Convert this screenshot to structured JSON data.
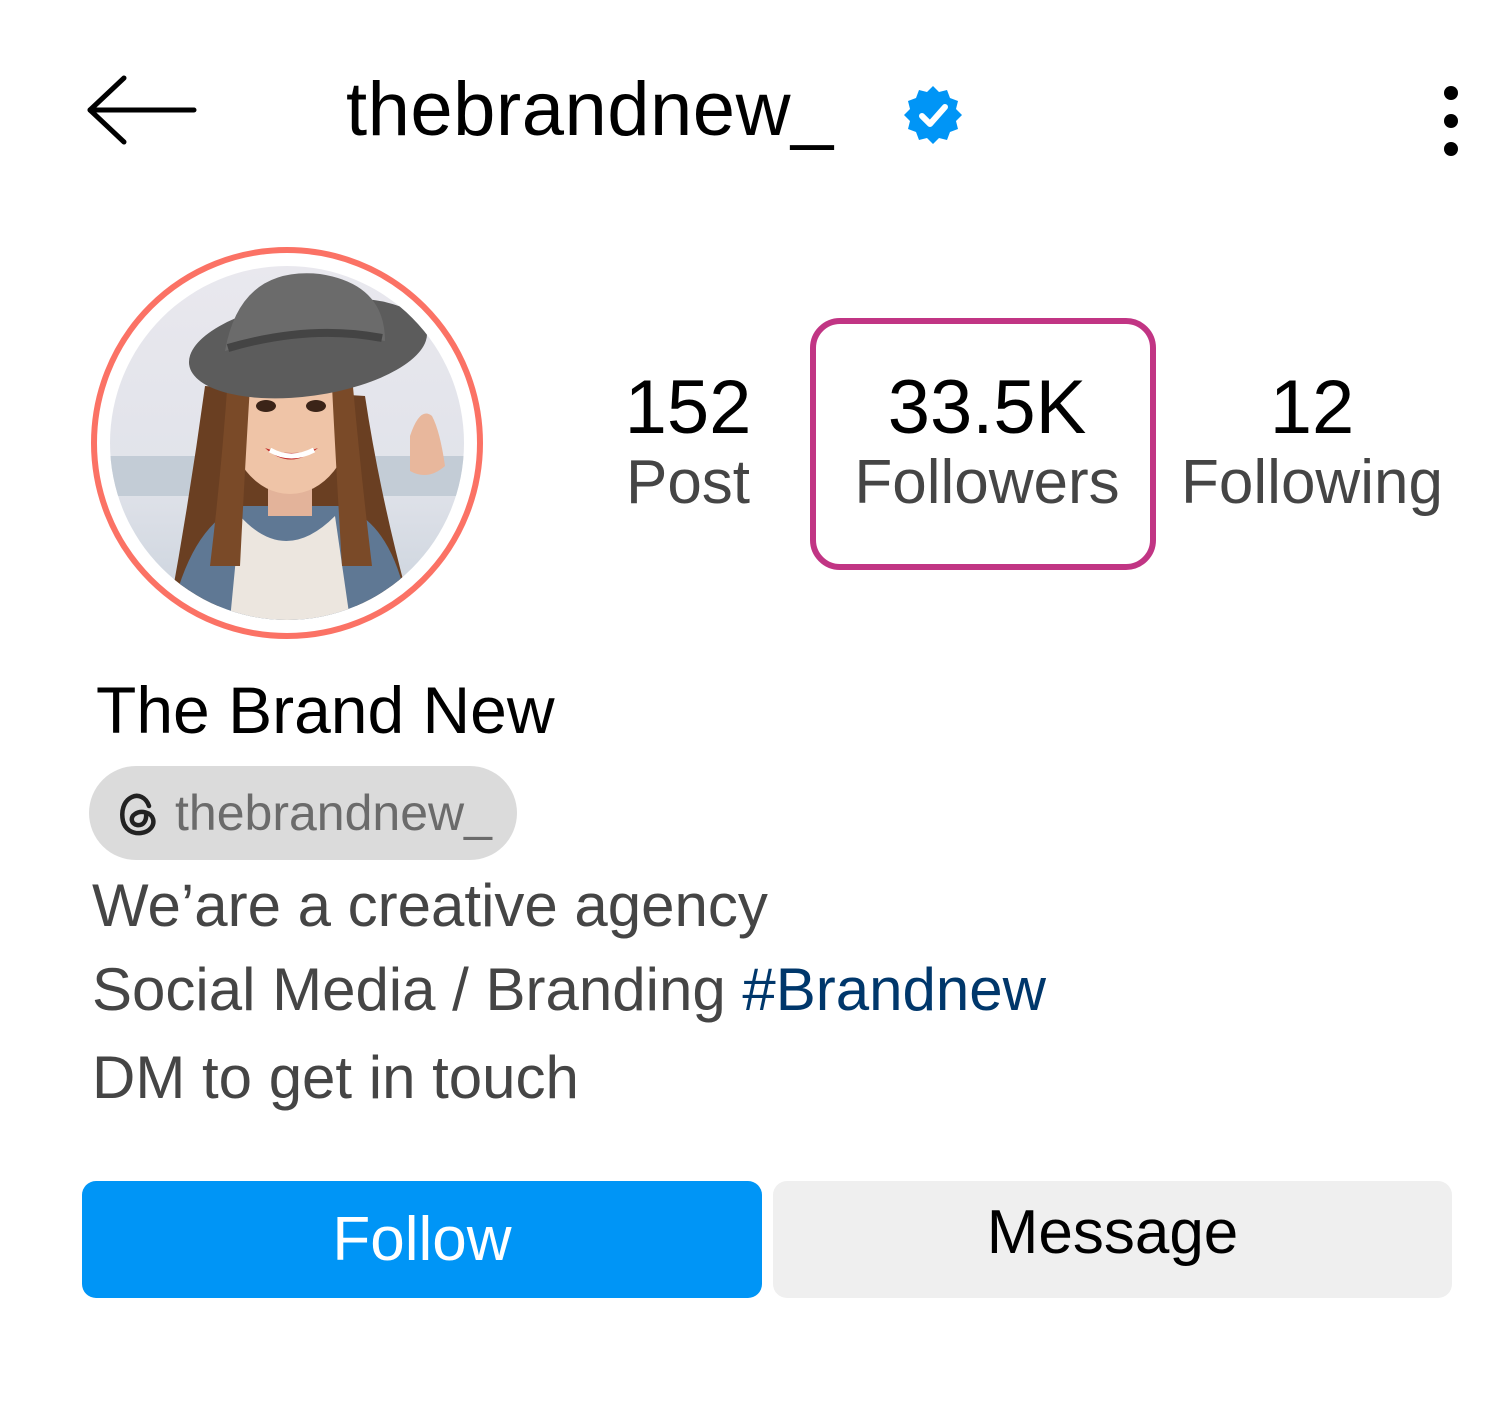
{
  "header": {
    "username": "thebrandnew_",
    "back_icon": "arrow-left-icon",
    "verified_icon": "verified-badge-icon",
    "more_icon": "more-vertical-icon"
  },
  "profile": {
    "display_name": "The Brand New",
    "threads_handle": "thebrandnew_",
    "threads_icon": "threads-icon"
  },
  "stats": {
    "posts": {
      "value": "152",
      "label": "Post"
    },
    "followers": {
      "value": "33.5K",
      "label": "Followers"
    },
    "following": {
      "value": "12",
      "label": "Following"
    }
  },
  "bio": {
    "line1": "We’are a creative agency",
    "line2_text": "Social Media / Branding ",
    "line2_hashtag": "#Brandnew",
    "line3": "DM to get in touch"
  },
  "actions": {
    "follow_label": "Follow",
    "message_label": "Message"
  },
  "colors": {
    "follow_button": "#0095f6",
    "message_button": "#efefef",
    "story_ring": "#fb7265",
    "highlight_box": "#c13584",
    "verified": "#0095f6",
    "hashtag": "#00376b"
  }
}
